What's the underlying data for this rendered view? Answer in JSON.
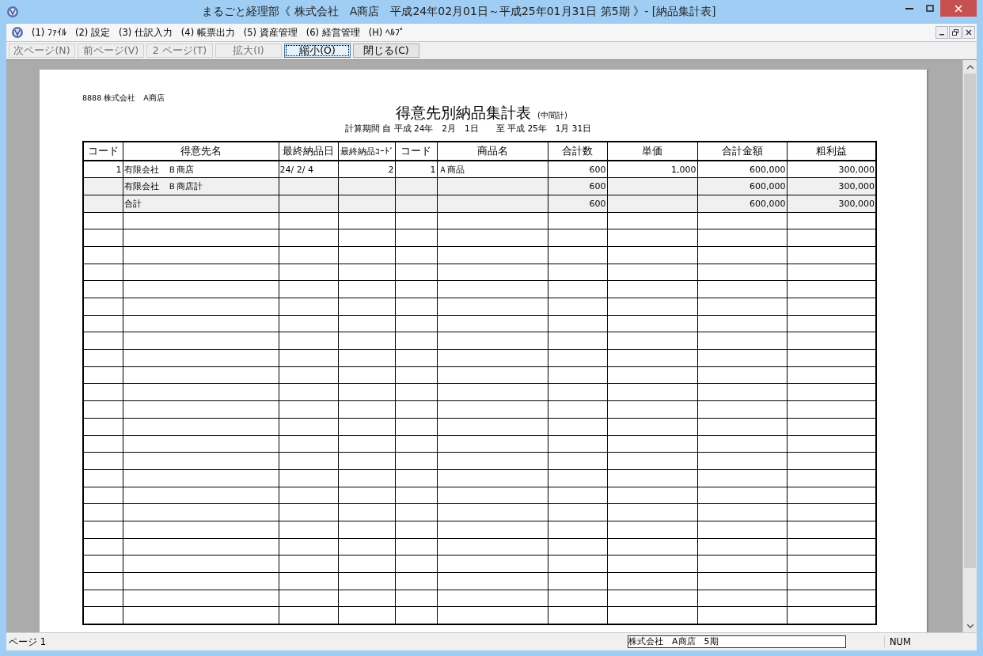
{
  "window": {
    "title": "まるごと経理部《 株式会社　A商店　平成24年02月01日～平成25年01月31日 第5期 》- [納品集計表]"
  },
  "menu": [
    {
      "label": "(1) ﾌｧｲﾙ"
    },
    {
      "label": "(2) 設定"
    },
    {
      "label": "(3) 仕訳入力"
    },
    {
      "label": "(4) 帳票出力"
    },
    {
      "label": "(5) 資産管理"
    },
    {
      "label": "(6) 経営管理"
    },
    {
      "label": "(H) ﾍﾙﾌﾟ"
    }
  ],
  "toolbar": [
    {
      "label": "次ページ(N)",
      "disabled": true,
      "focused": false
    },
    {
      "label": "前ページ(V)",
      "disabled": true,
      "focused": false
    },
    {
      "label": "2 ページ(T)",
      "disabled": true,
      "focused": false
    },
    {
      "label": "拡大(I)",
      "disabled": true,
      "focused": false
    },
    {
      "label": "縮小(O)",
      "disabled": false,
      "focused": true
    },
    {
      "label": "閉じる(C)",
      "disabled": false,
      "focused": false
    }
  ],
  "report": {
    "company": "8888 株式会社　A商店",
    "title": "得意先別納品集計表",
    "subtitle": "(中間計)",
    "period": "計算期間 自 平成 24年　2月　1日　　至 平成 25年　1月 31日"
  },
  "table": {
    "columns": [
      "コード",
      "得意先名",
      "最終納品日",
      "最終納品ｺｰﾄﾞ",
      "コード",
      "商品名",
      "合計数",
      "単価",
      "合計金額",
      "粗利益"
    ],
    "rows": [
      {
        "kind": "detail",
        "cells": [
          "1",
          "有限会社　Ｂ商店",
          "24/ 2/ 4",
          "2",
          "1",
          "Ａ商品",
          "600",
          "1,000",
          "600,000",
          "300,000"
        ]
      },
      {
        "kind": "subtotal",
        "cells": [
          null,
          "有限会社　Ｂ商店計",
          null,
          null,
          null,
          null,
          "600",
          null,
          "600,000",
          "300,000"
        ]
      },
      {
        "kind": "total",
        "cells": [
          null,
          "合計",
          null,
          null,
          null,
          null,
          "600",
          null,
          "600,000",
          "300,000"
        ]
      }
    ]
  },
  "status_bar": {
    "page": "ページ 1",
    "company": "株式会社　A商店　5期",
    "num": "NUM"
  }
}
